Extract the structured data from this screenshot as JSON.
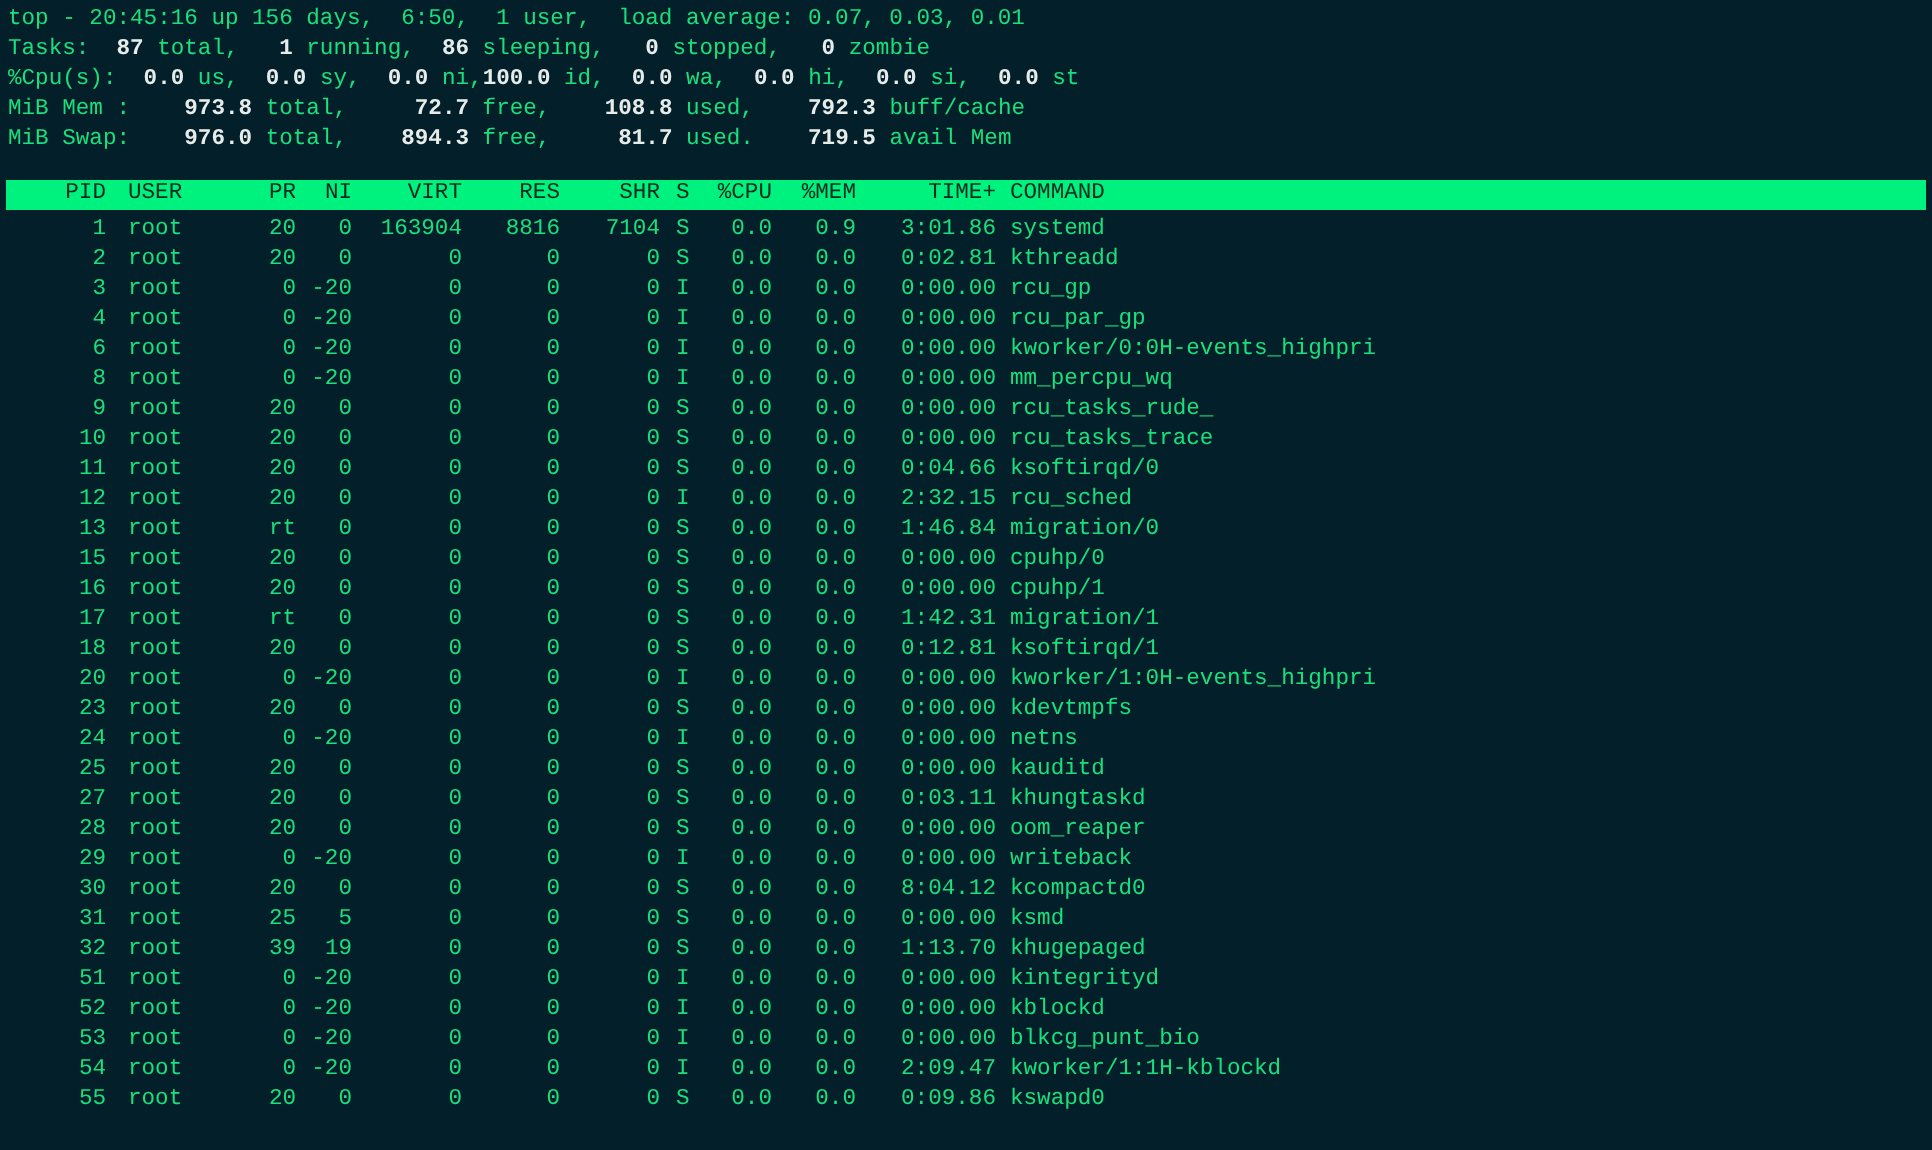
{
  "summary": [
    "top - 20:45:16 up 156 days,  6:50,  1 user,  load average: 0.07, 0.03, 0.01",
    "Tasks:  **87** total,   **1** running,  **86** sleeping,   **0** stopped,   **0** zombie",
    "%Cpu(s):  **0.0** us,  **0.0** sy,  **0.0** ni,**100.0** id,  **0.0** wa,  **0.0** hi,  **0.0** si,  **0.0** st",
    "MiB Mem :    **973.8** total,     **72.7** free,    **108.8** used,    **792.3** buff/cache",
    "MiB Swap:    **976.0** total,    **894.3** free,     **81.7** used.    **719.5** avail Mem"
  ],
  "table": {
    "columns": [
      "PID",
      "USER",
      "PR",
      "NI",
      "VIRT",
      "RES",
      "SHR",
      "S",
      "%CPU",
      "%MEM",
      "TIME+",
      "COMMAND"
    ],
    "rows": [
      [
        "1",
        "root",
        "20",
        "0",
        "163904",
        "8816",
        "7104",
        "S",
        "0.0",
        "0.9",
        "3:01.86",
        "systemd"
      ],
      [
        "2",
        "root",
        "20",
        "0",
        "0",
        "0",
        "0",
        "S",
        "0.0",
        "0.0",
        "0:02.81",
        "kthreadd"
      ],
      [
        "3",
        "root",
        "0",
        "-20",
        "0",
        "0",
        "0",
        "I",
        "0.0",
        "0.0",
        "0:00.00",
        "rcu_gp"
      ],
      [
        "4",
        "root",
        "0",
        "-20",
        "0",
        "0",
        "0",
        "I",
        "0.0",
        "0.0",
        "0:00.00",
        "rcu_par_gp"
      ],
      [
        "6",
        "root",
        "0",
        "-20",
        "0",
        "0",
        "0",
        "I",
        "0.0",
        "0.0",
        "0:00.00",
        "kworker/0:0H-events_highpri"
      ],
      [
        "8",
        "root",
        "0",
        "-20",
        "0",
        "0",
        "0",
        "I",
        "0.0",
        "0.0",
        "0:00.00",
        "mm_percpu_wq"
      ],
      [
        "9",
        "root",
        "20",
        "0",
        "0",
        "0",
        "0",
        "S",
        "0.0",
        "0.0",
        "0:00.00",
        "rcu_tasks_rude_"
      ],
      [
        "10",
        "root",
        "20",
        "0",
        "0",
        "0",
        "0",
        "S",
        "0.0",
        "0.0",
        "0:00.00",
        "rcu_tasks_trace"
      ],
      [
        "11",
        "root",
        "20",
        "0",
        "0",
        "0",
        "0",
        "S",
        "0.0",
        "0.0",
        "0:04.66",
        "ksoftirqd/0"
      ],
      [
        "12",
        "root",
        "20",
        "0",
        "0",
        "0",
        "0",
        "I",
        "0.0",
        "0.0",
        "2:32.15",
        "rcu_sched"
      ],
      [
        "13",
        "root",
        "rt",
        "0",
        "0",
        "0",
        "0",
        "S",
        "0.0",
        "0.0",
        "1:46.84",
        "migration/0"
      ],
      [
        "15",
        "root",
        "20",
        "0",
        "0",
        "0",
        "0",
        "S",
        "0.0",
        "0.0",
        "0:00.00",
        "cpuhp/0"
      ],
      [
        "16",
        "root",
        "20",
        "0",
        "0",
        "0",
        "0",
        "S",
        "0.0",
        "0.0",
        "0:00.00",
        "cpuhp/1"
      ],
      [
        "17",
        "root",
        "rt",
        "0",
        "0",
        "0",
        "0",
        "S",
        "0.0",
        "0.0",
        "1:42.31",
        "migration/1"
      ],
      [
        "18",
        "root",
        "20",
        "0",
        "0",
        "0",
        "0",
        "S",
        "0.0",
        "0.0",
        "0:12.81",
        "ksoftirqd/1"
      ],
      [
        "20",
        "root",
        "0",
        "-20",
        "0",
        "0",
        "0",
        "I",
        "0.0",
        "0.0",
        "0:00.00",
        "kworker/1:0H-events_highpri"
      ],
      [
        "23",
        "root",
        "20",
        "0",
        "0",
        "0",
        "0",
        "S",
        "0.0",
        "0.0",
        "0:00.00",
        "kdevtmpfs"
      ],
      [
        "24",
        "root",
        "0",
        "-20",
        "0",
        "0",
        "0",
        "I",
        "0.0",
        "0.0",
        "0:00.00",
        "netns"
      ],
      [
        "25",
        "root",
        "20",
        "0",
        "0",
        "0",
        "0",
        "S",
        "0.0",
        "0.0",
        "0:00.00",
        "kauditd"
      ],
      [
        "27",
        "root",
        "20",
        "0",
        "0",
        "0",
        "0",
        "S",
        "0.0",
        "0.0",
        "0:03.11",
        "khungtaskd"
      ],
      [
        "28",
        "root",
        "20",
        "0",
        "0",
        "0",
        "0",
        "S",
        "0.0",
        "0.0",
        "0:00.00",
        "oom_reaper"
      ],
      [
        "29",
        "root",
        "0",
        "-20",
        "0",
        "0",
        "0",
        "I",
        "0.0",
        "0.0",
        "0:00.00",
        "writeback"
      ],
      [
        "30",
        "root",
        "20",
        "0",
        "0",
        "0",
        "0",
        "S",
        "0.0",
        "0.0",
        "8:04.12",
        "kcompactd0"
      ],
      [
        "31",
        "root",
        "25",
        "5",
        "0",
        "0",
        "0",
        "S",
        "0.0",
        "0.0",
        "0:00.00",
        "ksmd"
      ],
      [
        "32",
        "root",
        "39",
        "19",
        "0",
        "0",
        "0",
        "S",
        "0.0",
        "0.0",
        "1:13.70",
        "khugepaged"
      ],
      [
        "51",
        "root",
        "0",
        "-20",
        "0",
        "0",
        "0",
        "I",
        "0.0",
        "0.0",
        "0:00.00",
        "kintegrityd"
      ],
      [
        "52",
        "root",
        "0",
        "-20",
        "0",
        "0",
        "0",
        "I",
        "0.0",
        "0.0",
        "0:00.00",
        "kblockd"
      ],
      [
        "53",
        "root",
        "0",
        "-20",
        "0",
        "0",
        "0",
        "I",
        "0.0",
        "0.0",
        "0:00.00",
        "blkcg_punt_bio"
      ],
      [
        "54",
        "root",
        "0",
        "-20",
        "0",
        "0",
        "0",
        "I",
        "0.0",
        "0.0",
        "2:09.47",
        "kworker/1:1H-kblockd"
      ],
      [
        "55",
        "root",
        "20",
        "0",
        "0",
        "0",
        "0",
        "S",
        "0.0",
        "0.0",
        "0:09.86",
        "kswapd0"
      ]
    ]
  }
}
